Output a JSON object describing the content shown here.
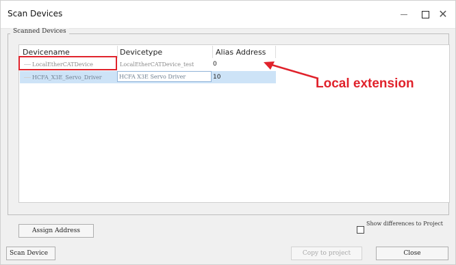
{
  "window": {
    "title": "Scan Devices"
  },
  "group": {
    "label": "Scanned Devices"
  },
  "table": {
    "headers": [
      "Devicename",
      "Devicetype",
      "Alias Address"
    ],
    "rows": [
      [
        "LocalEtherCATDevice",
        "LocalEtherCATDevice_test",
        "0"
      ],
      [
        "HCFA_X3E_Servo_Driver",
        "HCFA X3E Servo Driver",
        "10"
      ]
    ]
  },
  "annotation": {
    "text": "Local extension",
    "color": "#e0222b"
  },
  "buttons": {
    "assign": "Assign Address",
    "scan": "Scan Device",
    "copy": "Copy to project",
    "close": "Close"
  },
  "checkbox": {
    "label": "Show differences to Project",
    "checked": false
  },
  "colors": {
    "selection": "#cde3f7",
    "highlight": "#e0222b"
  }
}
